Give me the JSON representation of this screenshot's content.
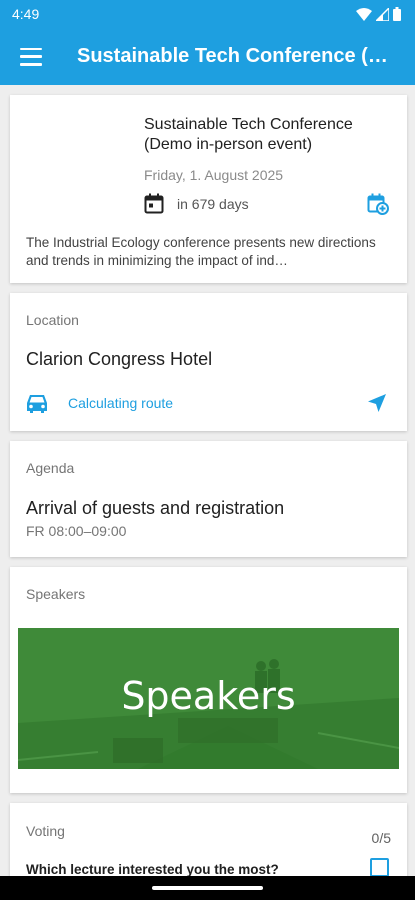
{
  "status_bar": {
    "time": "4:49"
  },
  "app_bar": {
    "title": "Sustainable Tech Conference (Demo in-person event)"
  },
  "event": {
    "title": "Sustainable Tech Conference (Demo in-person event)",
    "date": "Friday, 1. August 2025",
    "days_until": "in 679 days",
    "description": "The Industrial Ecology conference presents new directions and trends in minimizing the impact of ind…"
  },
  "location": {
    "label": "Location",
    "name": "Clarion Congress Hotel",
    "route_text": "Calculating route"
  },
  "agenda": {
    "label": "Agenda",
    "item_title": "Arrival of guests and registration",
    "item_time": "FR 08:00–09:00"
  },
  "speakers": {
    "label": "Speakers",
    "banner_text": "Speakers"
  },
  "voting": {
    "label": "Voting",
    "count": "0/5",
    "question": "Which lecture interested you the most?"
  },
  "colors": {
    "accent": "#1e9fe0",
    "banner_green": "#3f8a39"
  }
}
